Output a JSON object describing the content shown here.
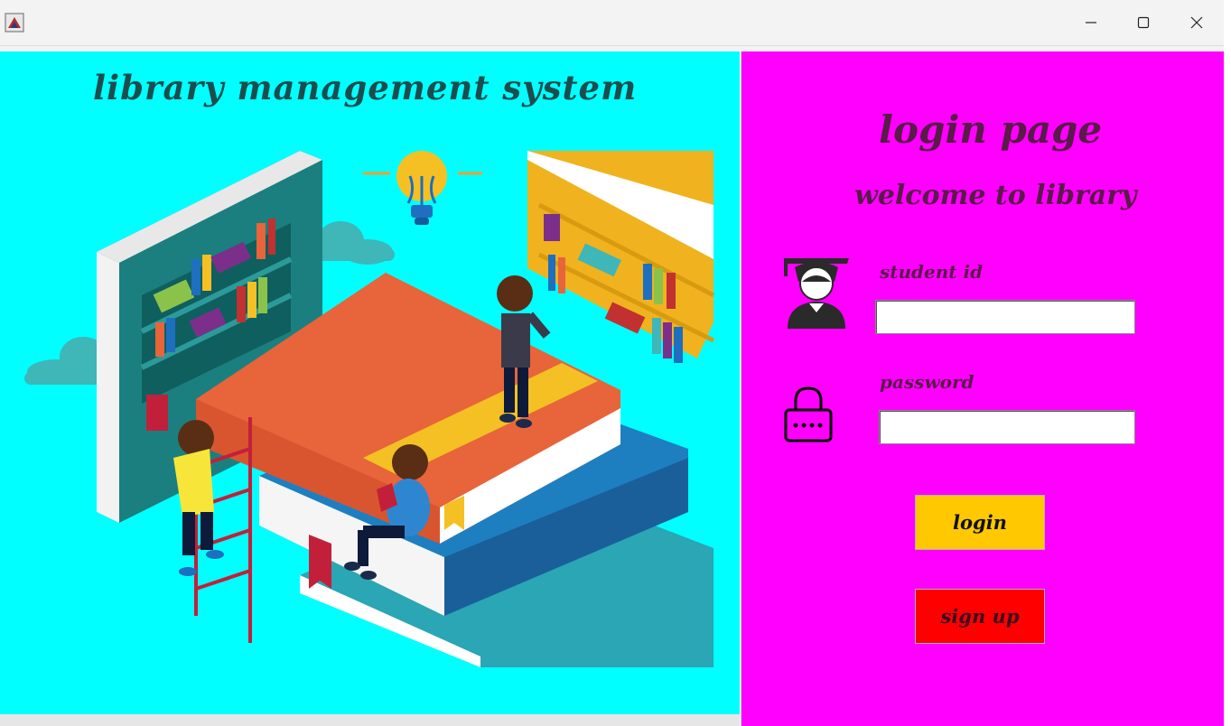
{
  "window": {
    "controls": [
      "minimize-icon",
      "maximize-icon",
      "close-icon"
    ]
  },
  "left_panel": {
    "title": "library management system",
    "background": "#00ffff"
  },
  "right_panel": {
    "background": "#ff00ff",
    "heading": "login page",
    "welcome": "welcome to library",
    "student_id_label": "student id",
    "student_id_value": "",
    "password_label": "password",
    "password_value": "",
    "login_button": "login",
    "signup_button": "sign up",
    "login_color": "#ffc800",
    "signup_color": "#ff0000"
  }
}
